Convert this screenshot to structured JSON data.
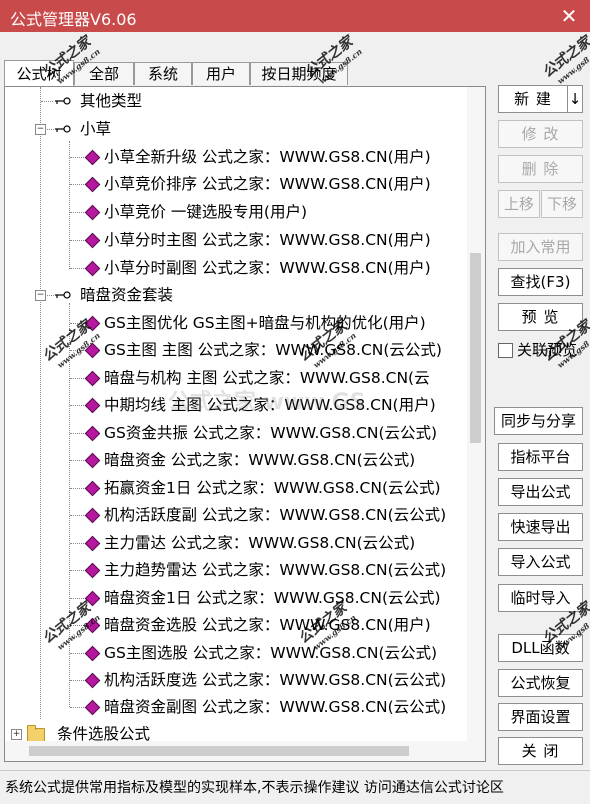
{
  "window": {
    "title": "公式管理器V6.06",
    "close_glyph": "✕"
  },
  "tabs": [
    "公式树",
    "全部",
    "系统",
    "用户",
    "按日期频度"
  ],
  "tree": [
    {
      "text": "其他类型",
      "level": 1,
      "icon": "key-icon"
    },
    {
      "text": "小草",
      "level": 1,
      "icon": "key-icon",
      "expanded": true
    },
    {
      "text": "小草全新升级 公式之家：WWW.GS8.CN(用户)",
      "level": 2,
      "icon": "gem-icon"
    },
    {
      "text": "小草竞价排序 公式之家：WWW.GS8.CN(用户)",
      "level": 2,
      "icon": "gem-icon"
    },
    {
      "text": "小草竞价 一键选股专用(用户)",
      "level": 2,
      "icon": "gem-icon"
    },
    {
      "text": "小草分时主图 公式之家：WWW.GS8.CN(用户)",
      "level": 2,
      "icon": "gem-icon"
    },
    {
      "text": "小草分时副图 公式之家：WWW.GS8.CN(用户)",
      "level": 2,
      "icon": "gem-icon"
    },
    {
      "text": "暗盘资金套装",
      "level": 1,
      "icon": "key-icon",
      "expanded": true
    },
    {
      "text": "GS主图优化 GS主图+暗盘与机构的优化(用户)",
      "level": 2,
      "icon": "gem-icon"
    },
    {
      "text": "GS主图 主图  公式之家：WWW.GS8.CN(云公式)",
      "level": 2,
      "icon": "gem-icon"
    },
    {
      "text": "暗盘与机构 主图      公式之家：WWW.GS8.CN(云",
      "level": 2,
      "icon": "gem-icon"
    },
    {
      "text": "中期均线 主图 公式之家：WWW.GS8.CN(用户)",
      "level": 2,
      "icon": "gem-icon"
    },
    {
      "text": "GS资金共振 公式之家：WWW.GS8.CN(云公式)",
      "level": 2,
      "icon": "gem-icon"
    },
    {
      "text": "暗盘资金 公式之家：WWW.GS8.CN(云公式)",
      "level": 2,
      "icon": "gem-icon"
    },
    {
      "text": "拓赢资金1日 公式之家：WWW.GS8.CN(云公式)",
      "level": 2,
      "icon": "gem-icon"
    },
    {
      "text": "机构活跃度副 公式之家：WWW.GS8.CN(云公式)",
      "level": 2,
      "icon": "gem-icon"
    },
    {
      "text": "主力雷达 公式之家：WWW.GS8.CN(云公式)",
      "level": 2,
      "icon": "gem-icon"
    },
    {
      "text": "主力趋势雷达 公式之家：WWW.GS8.CN(云公式)",
      "level": 2,
      "icon": "gem-icon"
    },
    {
      "text": "暗盘资金1日 公式之家：WWW.GS8.CN(云公式)",
      "level": 2,
      "icon": "gem-icon"
    },
    {
      "text": "暗盘资金选股 公式之家：WWW.GS8.CN(用户)",
      "level": 2,
      "icon": "gem-icon"
    },
    {
      "text": "GS主图选股 公式之家：WWW.GS8.CN(云公式)",
      "level": 2,
      "icon": "gem-icon"
    },
    {
      "text": "机构活跃度选 公式之家：WWW.GS8.CN(云公式)",
      "level": 2,
      "icon": "gem-icon"
    },
    {
      "text": "暗盘资金副图 公式之家：WWW.GS8.CN(云公式)",
      "level": 2,
      "icon": "gem-icon"
    },
    {
      "text": "条件选股公式",
      "level": 0,
      "icon": "folder-icon",
      "expanded": false
    }
  ],
  "buttons": {
    "new": "新 建",
    "new_arrow": "↓",
    "modify": "修 改",
    "delete": "删 除",
    "move_up": "上移",
    "move_down": "下移",
    "add_common": "加入常用",
    "find": "查找(F3)",
    "preview": "预 览",
    "sync_share": "同步与分享",
    "indicator_platform": "指标平台",
    "export_formula": "导出公式",
    "quick_export": "快速导出",
    "import_formula": "导入公式",
    "temp_import": "临时导入",
    "dll": "DLL函数",
    "formula_restore": "公式恢复",
    "ui_settings": "界面设置",
    "close": "关 闭"
  },
  "link_preview": {
    "label": "关联预览",
    "checked": false
  },
  "status": "系统公式提供常用指标及模型的实现样本,不表示操作建议  访问通达信公式讨论区",
  "watermark": {
    "text": "公式之家",
    "url": "www.gs8.cn",
    "center": "公式之家 www.GS"
  },
  "colors": {
    "titlebar": "#c94a4a",
    "formula_gem": "#b5179e",
    "folder": "#f2d16b"
  }
}
